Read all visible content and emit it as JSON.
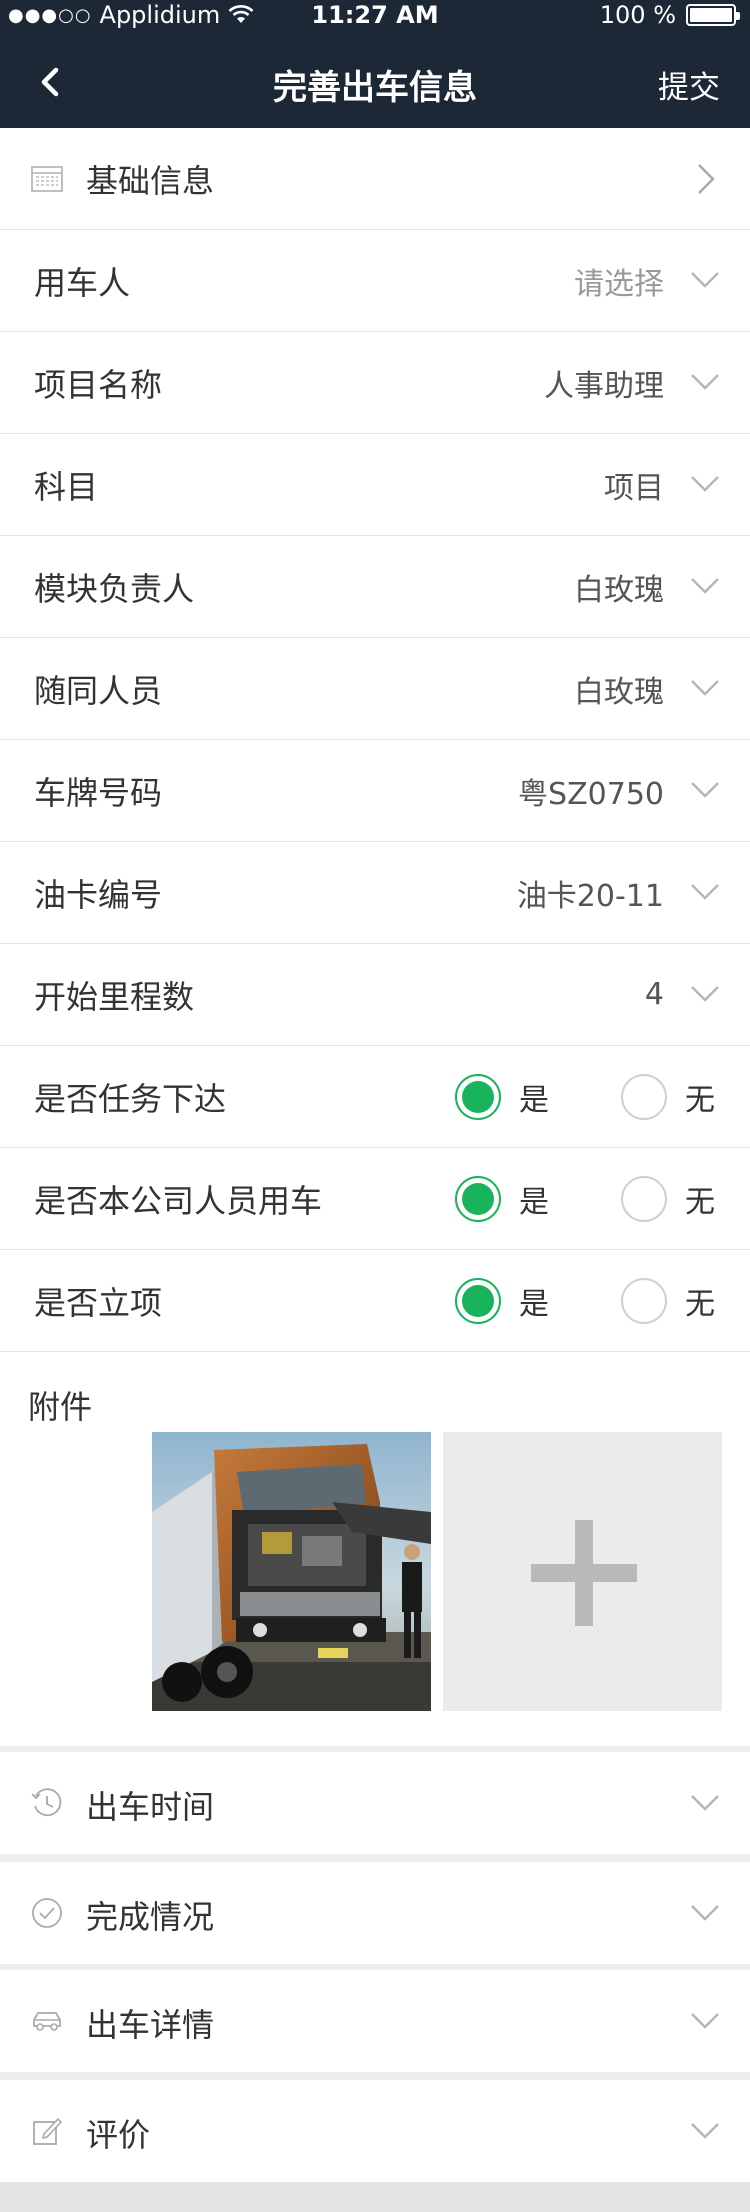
{
  "status_bar": {
    "carrier": "Applidium",
    "signal_dots": "●●●○○",
    "time": "11:27 AM",
    "battery": "100 %"
  },
  "nav": {
    "title": "完善出车信息",
    "submit": "提交",
    "back_icon": "chevron-left-icon"
  },
  "basic_info": {
    "label": "基础信息",
    "icon": "table-icon"
  },
  "fields": [
    {
      "label": "用车人",
      "value": "请选择",
      "placeholder": true
    },
    {
      "label": "项目名称",
      "value": "人事助理",
      "placeholder": false
    },
    {
      "label": "科目",
      "value": "项目",
      "placeholder": false
    },
    {
      "label": "模块负责人",
      "value": "白玫瑰",
      "placeholder": false
    },
    {
      "label": "随同人员",
      "value": "白玫瑰",
      "placeholder": false
    },
    {
      "label": "车牌号码",
      "value": "粤SZ0750",
      "placeholder": false
    },
    {
      "label": "油卡编号",
      "value": "油卡20-11",
      "placeholder": false
    },
    {
      "label": "开始里程数",
      "value": "4",
      "placeholder": false
    }
  ],
  "radios": [
    {
      "label": "是否任务下达",
      "yes": "是",
      "no": "无",
      "selected": "yes"
    },
    {
      "label": "是否本公司人员用车",
      "yes": "是",
      "no": "无",
      "selected": "yes"
    },
    {
      "label": "是否立项",
      "yes": "是",
      "no": "无",
      "selected": "yes"
    }
  ],
  "attachment": {
    "label": "附件",
    "add_icon": "plus-icon"
  },
  "sections": [
    {
      "label": "出车时间",
      "icon": "history-clock-icon"
    },
    {
      "label": "完成情况",
      "icon": "check-circle-icon"
    },
    {
      "label": "出车详情",
      "icon": "car-icon"
    },
    {
      "label": "评价",
      "icon": "edit-icon"
    }
  ],
  "colors": {
    "nav_bg": "#1d2837",
    "accent_green": "#19b35c"
  }
}
